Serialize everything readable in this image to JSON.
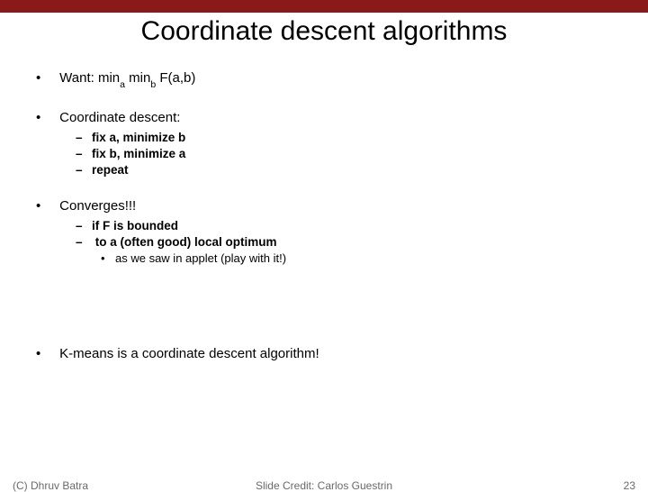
{
  "title": "Coordinate descent algorithms",
  "bullets": {
    "want_prefix": "Want: min",
    "want_sub_a": "a",
    "want_mid": " min",
    "want_sub_b": "b",
    "want_suffix": " F(a,b)",
    "cd_label": "Coordinate descent:",
    "cd_items": {
      "i1": "fix a, minimize b",
      "i2": "fix b, minimize a",
      "i3": "repeat"
    },
    "conv_label": "Converges!!!",
    "conv_items": {
      "c1": "if F is bounded",
      "c2": "to a (often good) local optimum",
      "c2_sub": "as we saw in applet (play with it!)"
    },
    "kmeans": "K-means is a coordinate descent algorithm!"
  },
  "footer": {
    "left": "(C) Dhruv Batra",
    "center": "Slide Credit: Carlos Guestrin",
    "right": "23"
  }
}
